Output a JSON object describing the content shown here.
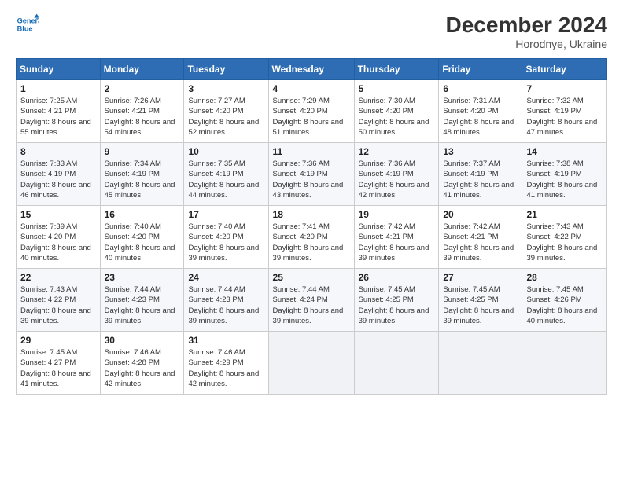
{
  "logo": {
    "line1": "General",
    "line2": "Blue"
  },
  "title": "December 2024",
  "subtitle": "Horodnye, Ukraine",
  "header_days": [
    "Sunday",
    "Monday",
    "Tuesday",
    "Wednesday",
    "Thursday",
    "Friday",
    "Saturday"
  ],
  "weeks": [
    [
      {
        "day": "1",
        "sunrise": "Sunrise: 7:25 AM",
        "sunset": "Sunset: 4:21 PM",
        "daylight": "Daylight: 8 hours and 55 minutes."
      },
      {
        "day": "2",
        "sunrise": "Sunrise: 7:26 AM",
        "sunset": "Sunset: 4:21 PM",
        "daylight": "Daylight: 8 hours and 54 minutes."
      },
      {
        "day": "3",
        "sunrise": "Sunrise: 7:27 AM",
        "sunset": "Sunset: 4:20 PM",
        "daylight": "Daylight: 8 hours and 52 minutes."
      },
      {
        "day": "4",
        "sunrise": "Sunrise: 7:29 AM",
        "sunset": "Sunset: 4:20 PM",
        "daylight": "Daylight: 8 hours and 51 minutes."
      },
      {
        "day": "5",
        "sunrise": "Sunrise: 7:30 AM",
        "sunset": "Sunset: 4:20 PM",
        "daylight": "Daylight: 8 hours and 50 minutes."
      },
      {
        "day": "6",
        "sunrise": "Sunrise: 7:31 AM",
        "sunset": "Sunset: 4:20 PM",
        "daylight": "Daylight: 8 hours and 48 minutes."
      },
      {
        "day": "7",
        "sunrise": "Sunrise: 7:32 AM",
        "sunset": "Sunset: 4:19 PM",
        "daylight": "Daylight: 8 hours and 47 minutes."
      }
    ],
    [
      {
        "day": "8",
        "sunrise": "Sunrise: 7:33 AM",
        "sunset": "Sunset: 4:19 PM",
        "daylight": "Daylight: 8 hours and 46 minutes."
      },
      {
        "day": "9",
        "sunrise": "Sunrise: 7:34 AM",
        "sunset": "Sunset: 4:19 PM",
        "daylight": "Daylight: 8 hours and 45 minutes."
      },
      {
        "day": "10",
        "sunrise": "Sunrise: 7:35 AM",
        "sunset": "Sunset: 4:19 PM",
        "daylight": "Daylight: 8 hours and 44 minutes."
      },
      {
        "day": "11",
        "sunrise": "Sunrise: 7:36 AM",
        "sunset": "Sunset: 4:19 PM",
        "daylight": "Daylight: 8 hours and 43 minutes."
      },
      {
        "day": "12",
        "sunrise": "Sunrise: 7:36 AM",
        "sunset": "Sunset: 4:19 PM",
        "daylight": "Daylight: 8 hours and 42 minutes."
      },
      {
        "day": "13",
        "sunrise": "Sunrise: 7:37 AM",
        "sunset": "Sunset: 4:19 PM",
        "daylight": "Daylight: 8 hours and 41 minutes."
      },
      {
        "day": "14",
        "sunrise": "Sunrise: 7:38 AM",
        "sunset": "Sunset: 4:19 PM",
        "daylight": "Daylight: 8 hours and 41 minutes."
      }
    ],
    [
      {
        "day": "15",
        "sunrise": "Sunrise: 7:39 AM",
        "sunset": "Sunset: 4:20 PM",
        "daylight": "Daylight: 8 hours and 40 minutes."
      },
      {
        "day": "16",
        "sunrise": "Sunrise: 7:40 AM",
        "sunset": "Sunset: 4:20 PM",
        "daylight": "Daylight: 8 hours and 40 minutes."
      },
      {
        "day": "17",
        "sunrise": "Sunrise: 7:40 AM",
        "sunset": "Sunset: 4:20 PM",
        "daylight": "Daylight: 8 hours and 39 minutes."
      },
      {
        "day": "18",
        "sunrise": "Sunrise: 7:41 AM",
        "sunset": "Sunset: 4:20 PM",
        "daylight": "Daylight: 8 hours and 39 minutes."
      },
      {
        "day": "19",
        "sunrise": "Sunrise: 7:42 AM",
        "sunset": "Sunset: 4:21 PM",
        "daylight": "Daylight: 8 hours and 39 minutes."
      },
      {
        "day": "20",
        "sunrise": "Sunrise: 7:42 AM",
        "sunset": "Sunset: 4:21 PM",
        "daylight": "Daylight: 8 hours and 39 minutes."
      },
      {
        "day": "21",
        "sunrise": "Sunrise: 7:43 AM",
        "sunset": "Sunset: 4:22 PM",
        "daylight": "Daylight: 8 hours and 39 minutes."
      }
    ],
    [
      {
        "day": "22",
        "sunrise": "Sunrise: 7:43 AM",
        "sunset": "Sunset: 4:22 PM",
        "daylight": "Daylight: 8 hours and 39 minutes."
      },
      {
        "day": "23",
        "sunrise": "Sunrise: 7:44 AM",
        "sunset": "Sunset: 4:23 PM",
        "daylight": "Daylight: 8 hours and 39 minutes."
      },
      {
        "day": "24",
        "sunrise": "Sunrise: 7:44 AM",
        "sunset": "Sunset: 4:23 PM",
        "daylight": "Daylight: 8 hours and 39 minutes."
      },
      {
        "day": "25",
        "sunrise": "Sunrise: 7:44 AM",
        "sunset": "Sunset: 4:24 PM",
        "daylight": "Daylight: 8 hours and 39 minutes."
      },
      {
        "day": "26",
        "sunrise": "Sunrise: 7:45 AM",
        "sunset": "Sunset: 4:25 PM",
        "daylight": "Daylight: 8 hours and 39 minutes."
      },
      {
        "day": "27",
        "sunrise": "Sunrise: 7:45 AM",
        "sunset": "Sunset: 4:25 PM",
        "daylight": "Daylight: 8 hours and 39 minutes."
      },
      {
        "day": "28",
        "sunrise": "Sunrise: 7:45 AM",
        "sunset": "Sunset: 4:26 PM",
        "daylight": "Daylight: 8 hours and 40 minutes."
      }
    ],
    [
      {
        "day": "29",
        "sunrise": "Sunrise: 7:45 AM",
        "sunset": "Sunset: 4:27 PM",
        "daylight": "Daylight: 8 hours and 41 minutes."
      },
      {
        "day": "30",
        "sunrise": "Sunrise: 7:46 AM",
        "sunset": "Sunset: 4:28 PM",
        "daylight": "Daylight: 8 hours and 42 minutes."
      },
      {
        "day": "31",
        "sunrise": "Sunrise: 7:46 AM",
        "sunset": "Sunset: 4:29 PM",
        "daylight": "Daylight: 8 hours and 42 minutes."
      },
      null,
      null,
      null,
      null
    ]
  ]
}
